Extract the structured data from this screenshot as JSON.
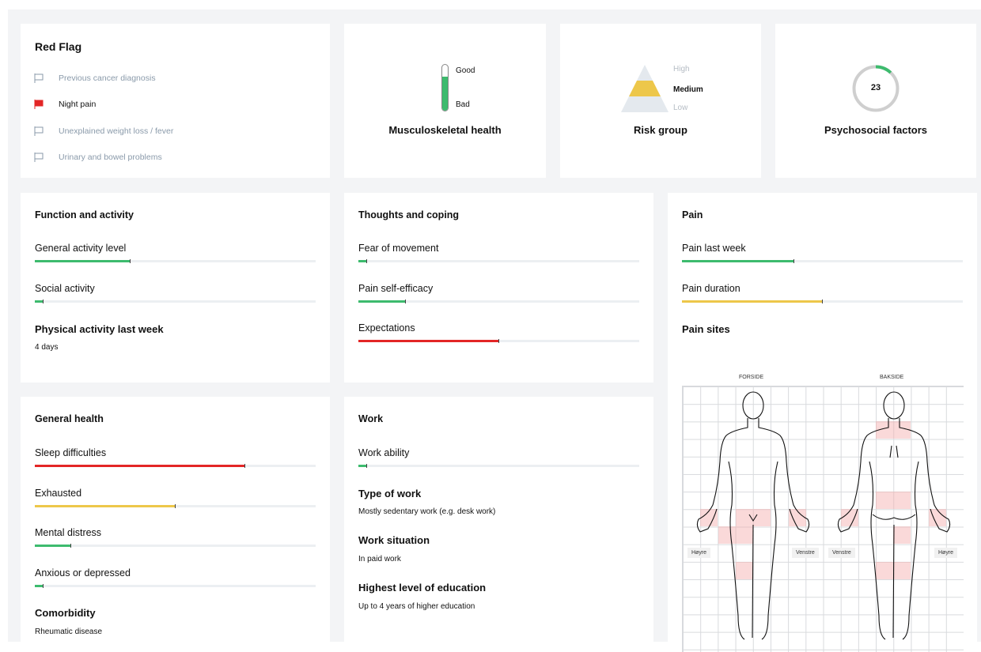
{
  "red_flag": {
    "title": "Red Flag",
    "items": [
      {
        "label": "Previous cancer diagnosis",
        "active": false
      },
      {
        "label": "Night pain",
        "active": true
      },
      {
        "label": "Unexplained weight loss / fever",
        "active": false
      },
      {
        "label": "Urinary and bowel problems",
        "active": false
      }
    ]
  },
  "musculoskeletal": {
    "title": "Musculoskeletal health",
    "good_label": "Good",
    "bad_label": "Bad",
    "level": 0.75
  },
  "risk": {
    "title": "Risk group",
    "high": "High",
    "medium": "Medium",
    "low": "Low",
    "current": "Medium"
  },
  "psychosocial": {
    "title": "Psychosocial factors",
    "score": "23",
    "fraction": 0.12
  },
  "function": {
    "title": "Function and activity",
    "general_activity": {
      "label": "General activity level",
      "value": 0.34,
      "color": "#3dbb6e"
    },
    "social_activity": {
      "label": "Social activity",
      "value": 0.03,
      "color": "#3dbb6e"
    },
    "physical_title": "Physical activity last week",
    "physical_value": "4 days"
  },
  "thoughts": {
    "title": "Thoughts and coping",
    "fear": {
      "label": "Fear of movement",
      "value": 0.03,
      "color": "#3dbb6e"
    },
    "self_efficacy": {
      "label": "Pain self-efficacy",
      "value": 0.17,
      "color": "#3dbb6e"
    },
    "expectations": {
      "label": "Expectations",
      "value": 0.5,
      "color": "#e32626"
    }
  },
  "pain": {
    "title": "Pain",
    "last_week": {
      "label": "Pain last week",
      "value": 0.4,
      "color": "#3dbb6e"
    },
    "duration": {
      "label": "Pain duration",
      "value": 0.5,
      "color": "#edc74a"
    },
    "sites_title": "Pain sites",
    "front_label": "FORSIDE",
    "back_label": "BAKSIDE",
    "tag_hoyre_front": "Høyre",
    "tag_venstre_front": "Venstre",
    "tag_venstre_back": "Venstre",
    "tag_hoyre_back": "Høyre"
  },
  "general_health": {
    "title": "General health",
    "sleep": {
      "label": "Sleep difficulties",
      "value": 0.75,
      "color": "#e32626"
    },
    "exhausted": {
      "label": "Exhausted",
      "value": 0.5,
      "color": "#edc74a"
    },
    "mental": {
      "label": "Mental distress",
      "value": 0.13,
      "color": "#3dbb6e"
    },
    "anxious": {
      "label": "Anxious or depressed",
      "value": 0.03,
      "color": "#3dbb6e"
    },
    "comorbidity_title": "Comorbidity",
    "comorbidity_value": "Rheumatic disease"
  },
  "work": {
    "title": "Work",
    "ability": {
      "label": "Work ability",
      "value": 0.03,
      "color": "#3dbb6e"
    },
    "type_title": "Type of work",
    "type_value": "Mostly sedentary work (e.g. desk work)",
    "situation_title": "Work situation",
    "situation_value": "In paid work",
    "education_title": "Highest level of education",
    "education_value": "Up to 4 years of higher education"
  }
}
